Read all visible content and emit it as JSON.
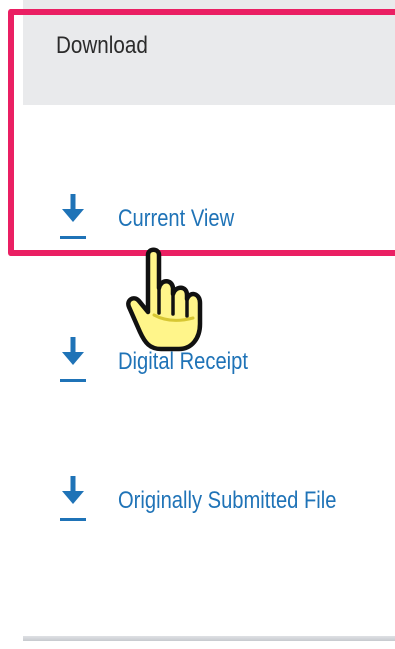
{
  "download_panel": {
    "title": "Download",
    "items": [
      {
        "label": "Current View",
        "icon": "download-icon"
      },
      {
        "label": "Digital Receipt",
        "icon": "download-icon"
      },
      {
        "label": "Originally Submitted File",
        "icon": "download-icon"
      }
    ]
  },
  "colors": {
    "header_bg": "#e9eaec",
    "link": "#1f73b7",
    "highlight": "#ea1f63",
    "cursor_fill": "#fff58a"
  },
  "cursor": {
    "type": "hand-pointer-icon"
  }
}
